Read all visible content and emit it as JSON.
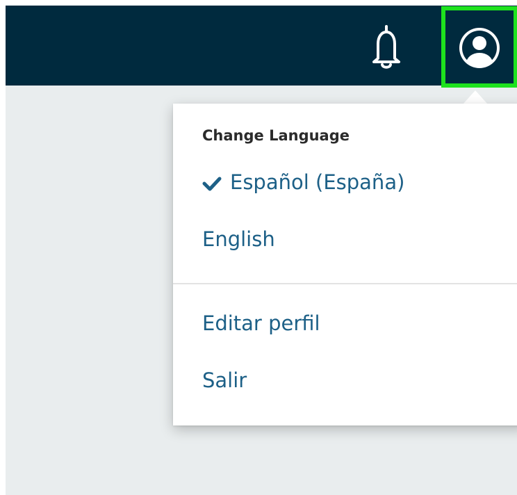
{
  "header": {
    "notification_icon": "bell-icon",
    "user_icon": "user-circle-icon",
    "background_color": "#002a3e",
    "highlight_color": "#1ee21e"
  },
  "menu": {
    "language_heading": "Change Language",
    "languages": [
      {
        "label": "Español (España)",
        "selected": true,
        "icon": "check-icon"
      },
      {
        "label": "English",
        "selected": false
      }
    ],
    "edit_profile": "Editar perfil",
    "logout": "Salir",
    "link_color": "#1d6087"
  }
}
